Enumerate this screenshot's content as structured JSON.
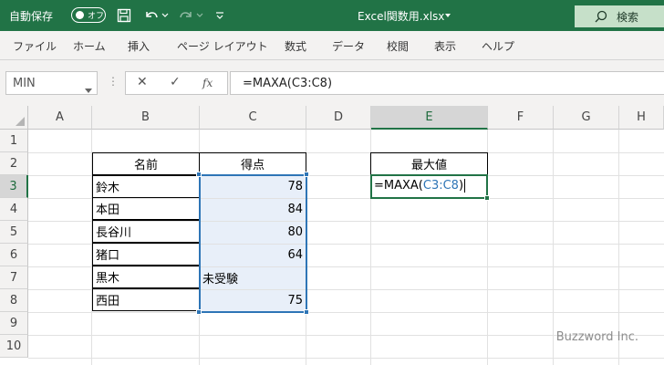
{
  "titlebar": {
    "autosave_label": "自動保存",
    "autosave_state": "オフ",
    "filename": "Excel関数用.xlsx",
    "search_label": "検索",
    "icons": [
      "save-icon",
      "undo-icon",
      "redo-icon",
      "customize-icon",
      "search-icon"
    ]
  },
  "ribbon": {
    "tabs": [
      "ファイル",
      "ホーム",
      "挿入",
      "ページ レイアウト",
      "数式",
      "データ",
      "校閲",
      "表示",
      "ヘルプ"
    ]
  },
  "formula_bar": {
    "namebox": "MIN",
    "cancel": "✕",
    "enter": "✓",
    "fx": "fx",
    "formula": "=MAXA(C3:C8)"
  },
  "grid": {
    "columns": [
      "A",
      "B",
      "C",
      "D",
      "E",
      "F",
      "G",
      "H"
    ],
    "rows": [
      "1",
      "2",
      "3",
      "4",
      "5",
      "6",
      "7",
      "8",
      "9",
      "10"
    ],
    "selected_column": "E",
    "selected_row": "3"
  },
  "table": {
    "header_name": "名前",
    "header_score": "得点",
    "rows": [
      {
        "name": "鈴木",
        "score": "78"
      },
      {
        "name": "本田",
        "score": "84"
      },
      {
        "name": "長谷川",
        "score": "80"
      },
      {
        "name": "猪口",
        "score": "64"
      },
      {
        "name": "黒木",
        "score": "未受験"
      },
      {
        "name": "西田",
        "score": "75"
      }
    ]
  },
  "result": {
    "header": "最大値",
    "formula_prefix": "=MAXA(",
    "formula_ref": "C3:C8",
    "formula_suffix": ")"
  },
  "watermark": "Buzzword Inc.",
  "colors": {
    "excel_green": "#217346",
    "range_blue": "#2e75b6",
    "range_fill": "#e8eff9"
  }
}
